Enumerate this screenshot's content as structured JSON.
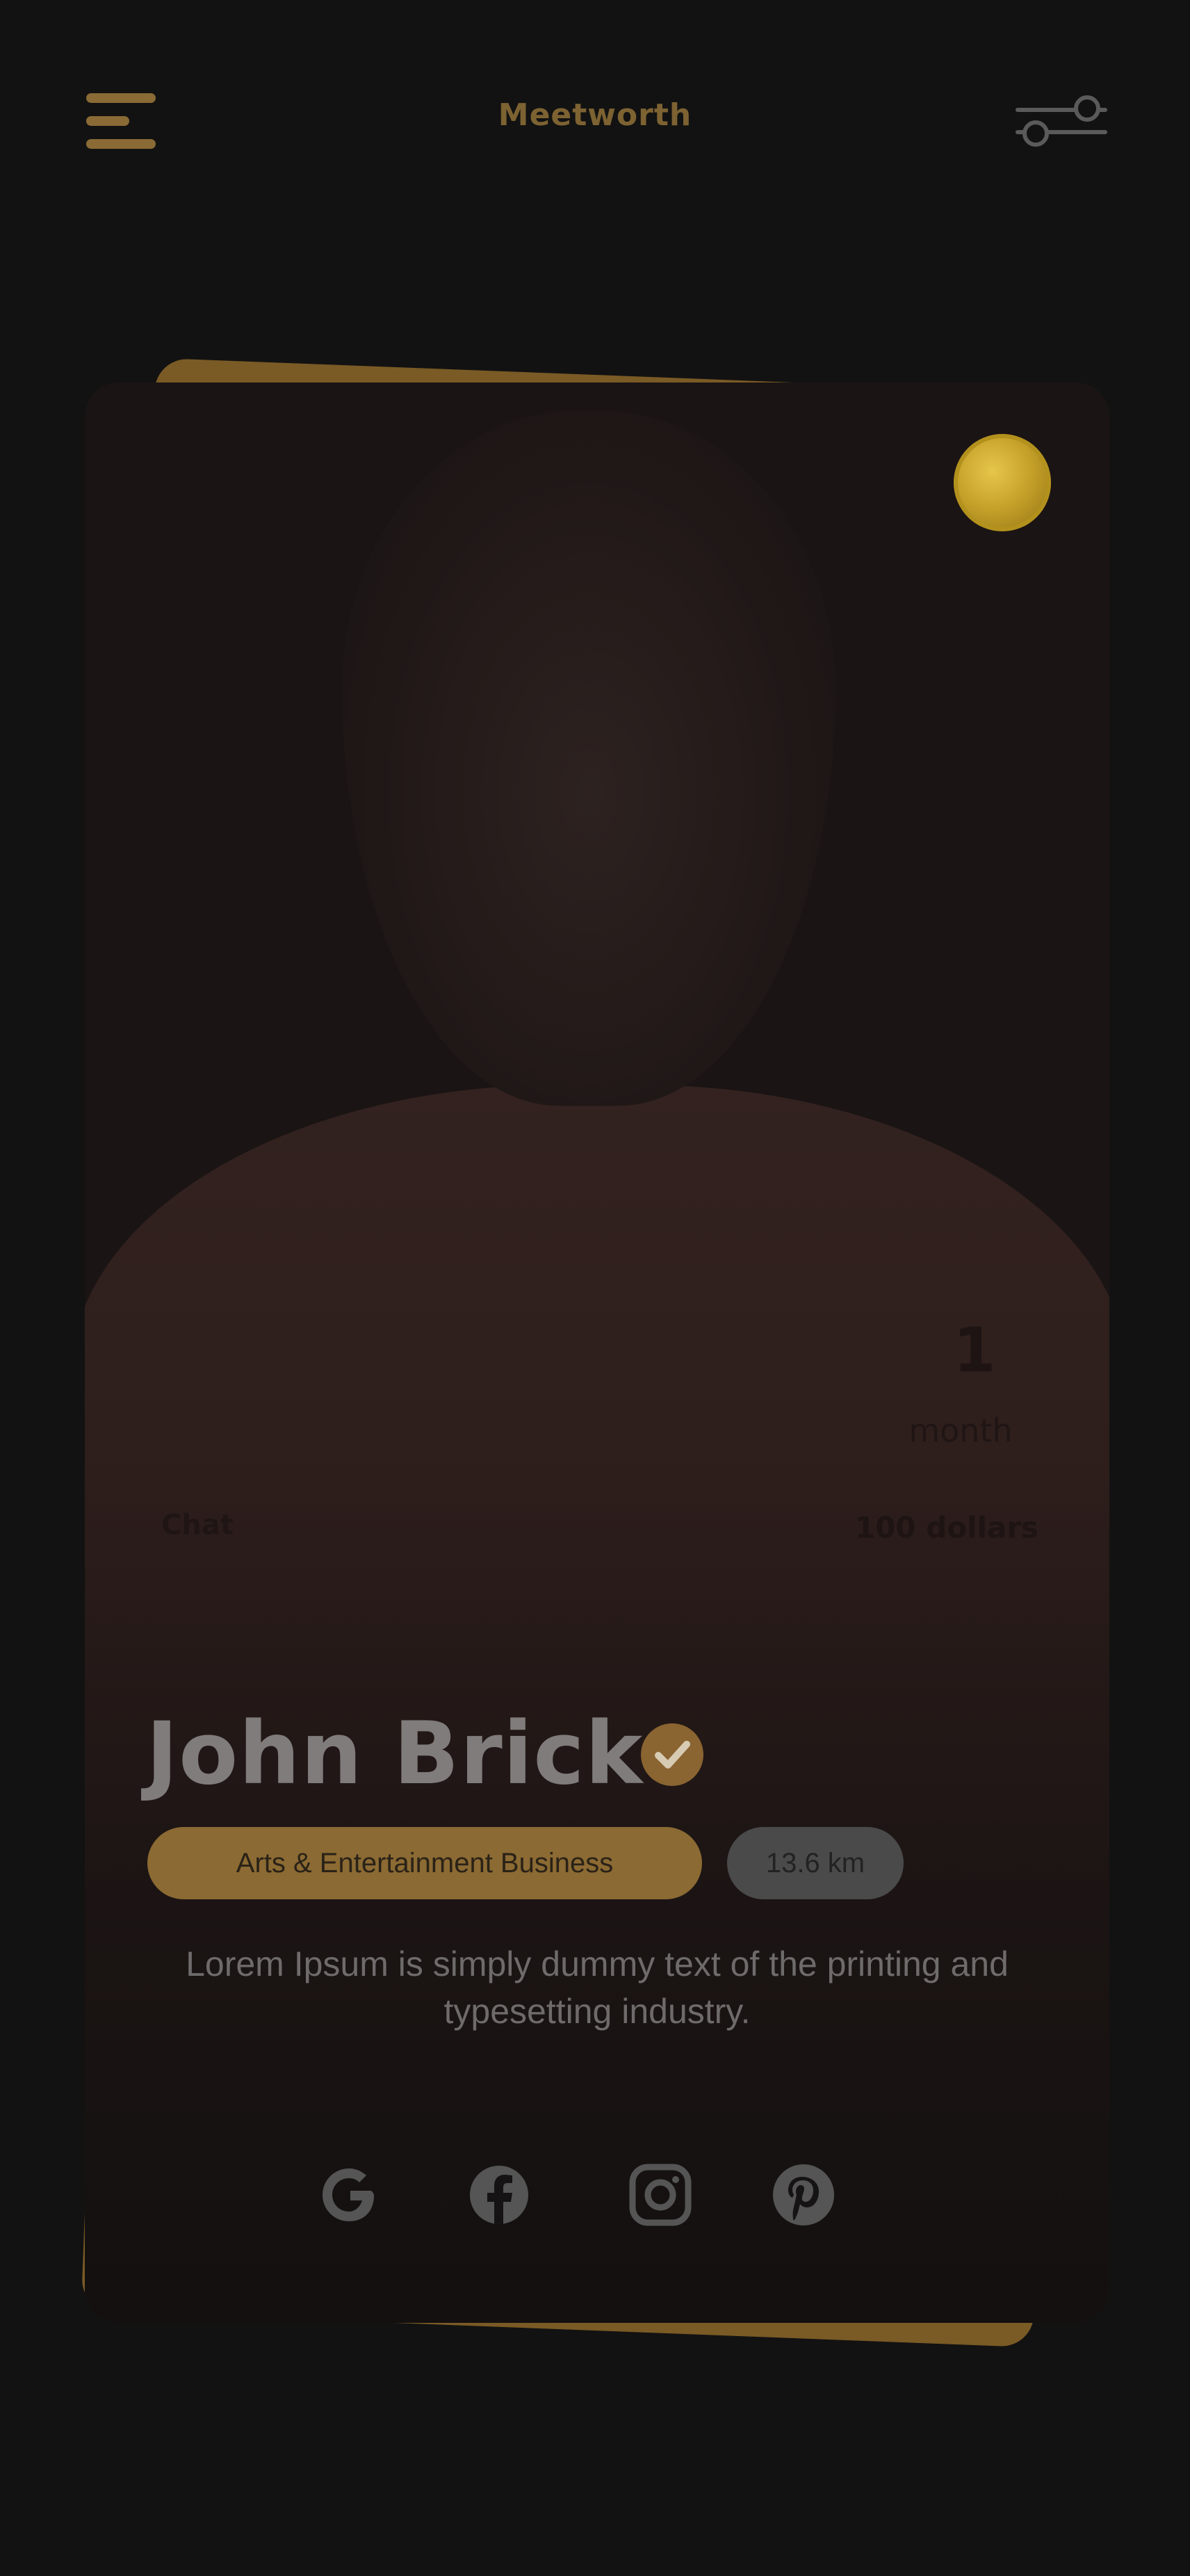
{
  "header": {
    "logo": "Meetworth",
    "menu_icon": "hamburger-menu-icon",
    "filter_icon": "sliders-filter-icon"
  },
  "profile": {
    "name": "John Brick",
    "verified_icon": "check-badge-icon",
    "category": "Arts & Entertainment Business",
    "distance": "13.6 km",
    "description": "Lorem Ipsum is simply dummy text of the printing and typesetting industry.",
    "badge_icon": "gold-coin-icon",
    "stats": {
      "duration_value": "1",
      "duration_unit": "month",
      "price": "100 dollars",
      "left_label": "Chat"
    }
  },
  "social": [
    {
      "name": "google-icon"
    },
    {
      "name": "facebook-icon"
    },
    {
      "name": "instagram-icon"
    },
    {
      "name": "pinterest-icon"
    }
  ],
  "colors": {
    "background": "#121212",
    "accent": "#8b6a33",
    "text_muted": "#6e6b6a"
  }
}
